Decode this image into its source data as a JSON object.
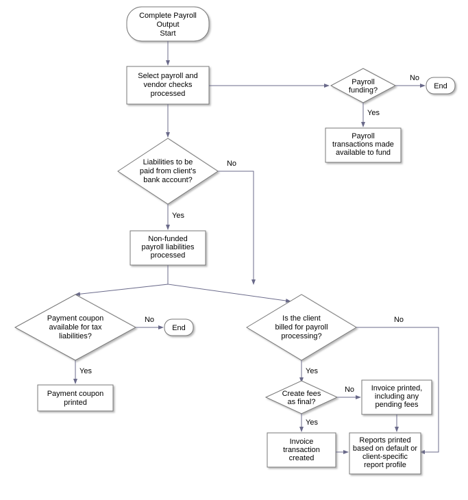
{
  "chart_data": {
    "type": "flowchart",
    "title": "Complete Payroll Output Start",
    "nodes": [
      {
        "id": "start",
        "type": "terminator",
        "label": "Complete Payroll Output Start"
      },
      {
        "id": "select",
        "type": "process",
        "label": "Select payroll and vendor checks processed"
      },
      {
        "id": "funding",
        "type": "decision",
        "label": "Payroll funding?"
      },
      {
        "id": "end1",
        "type": "terminator",
        "label": "End"
      },
      {
        "id": "avail",
        "type": "process",
        "label": "Payroll transactions made available to fund"
      },
      {
        "id": "liab",
        "type": "decision",
        "label": "Liabilities to be paid from client's bank account?"
      },
      {
        "id": "nonfund",
        "type": "process",
        "label": "Non-funded payroll liabilities processed"
      },
      {
        "id": "coupon",
        "type": "decision",
        "label": "Payment coupon available for tax liabilities?"
      },
      {
        "id": "end2",
        "type": "terminator",
        "label": "End"
      },
      {
        "id": "printed",
        "type": "process",
        "label": "Payment coupon printed"
      },
      {
        "id": "billed",
        "type": "decision",
        "label": "Is the client billed for payroll processing?"
      },
      {
        "id": "final",
        "type": "decision",
        "label": "Create fees as final?"
      },
      {
        "id": "invoice",
        "type": "process",
        "label": "Invoice printed, including any pending fees"
      },
      {
        "id": "trans",
        "type": "process",
        "label": "Invoice transaction created"
      },
      {
        "id": "reports",
        "type": "process",
        "label": "Reports printed based on default or client-specific report profile"
      }
    ],
    "edges": [
      {
        "from": "start",
        "to": "select"
      },
      {
        "from": "select",
        "to": "funding"
      },
      {
        "from": "funding",
        "to": "end1",
        "label": "No"
      },
      {
        "from": "funding",
        "to": "avail",
        "label": "Yes"
      },
      {
        "from": "select",
        "to": "liab"
      },
      {
        "from": "liab",
        "to": "nonfund",
        "label": "Yes"
      },
      {
        "from": "liab",
        "to": "billed",
        "label": "No"
      },
      {
        "from": "nonfund",
        "to": "coupon"
      },
      {
        "from": "nonfund",
        "to": "billed"
      },
      {
        "from": "coupon",
        "to": "end2",
        "label": "No"
      },
      {
        "from": "coupon",
        "to": "printed",
        "label": "Yes"
      },
      {
        "from": "billed",
        "to": "final",
        "label": "Yes"
      },
      {
        "from": "billed",
        "to": "reports",
        "label": "No"
      },
      {
        "from": "final",
        "to": "invoice",
        "label": "No"
      },
      {
        "from": "final",
        "to": "trans",
        "label": "Yes"
      },
      {
        "from": "trans",
        "to": "reports"
      },
      {
        "from": "invoice",
        "to": "reports"
      }
    ]
  },
  "labels": {
    "yes": "Yes",
    "no": "No",
    "end": "End",
    "start_l1": "Complete Payroll",
    "start_l2": "Output",
    "start_l3": "Start",
    "select_l1": "Select payroll and",
    "select_l2": "vendor checks",
    "select_l3": "processed",
    "funding_l1": "Payroll",
    "funding_l2": "funding?",
    "avail_l1": "Payroll",
    "avail_l2": "transactions made",
    "avail_l3": "available to fund",
    "liab_l1": "Liabilities to be",
    "liab_l2": "paid from client's",
    "liab_l3": "bank account?",
    "nonfund_l1": "Non-funded",
    "nonfund_l2": "payroll liabilities",
    "nonfund_l3": "processed",
    "coupon_l1": "Payment coupon",
    "coupon_l2": "available for tax",
    "coupon_l3": "liabilities?",
    "printed_l1": "Payment coupon",
    "printed_l2": "printed",
    "billed_l1": "Is the client",
    "billed_l2": "billed for payroll",
    "billed_l3": "processing?",
    "final_l1": "Create fees",
    "final_l2": "as final?",
    "invoice_l1": "Invoice printed,",
    "invoice_l2": "including any",
    "invoice_l3": "pending fees",
    "trans_l1": "Invoice",
    "trans_l2": "transaction",
    "trans_l3": "created",
    "reports_l1": "Reports printed",
    "reports_l2": "based on default or",
    "reports_l3": "client-specific",
    "reports_l4": "report profile"
  }
}
